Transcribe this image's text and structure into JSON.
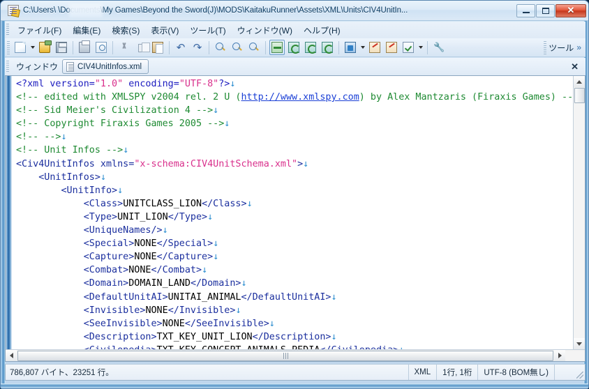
{
  "window": {
    "title": "C:\\Users\\            \\Documents\\My Games\\Beyond the Sword(J)\\MODS\\KaitakuRunner\\Assets\\XML\\Units\\CIV4UnitIn...",
    "app_icon_name": "editor-app-icon",
    "buttons": {
      "minimize": "–",
      "maximize": "□",
      "close": "✕"
    }
  },
  "menubar": {
    "items": [
      {
        "label": "ファイル(F)"
      },
      {
        "label": "編集(E)"
      },
      {
        "label": "検索(S)"
      },
      {
        "label": "表示(V)"
      },
      {
        "label": "ツール(T)"
      },
      {
        "label": "ウィンドウ(W)"
      },
      {
        "label": "ヘルプ(H)"
      }
    ]
  },
  "toolbar": {
    "tools_label": "ツール",
    "overflow_chevron": "»",
    "icons": [
      "new-file-icon",
      "new-file-dropdown-arrow",
      "open-folder-icon",
      "save-icon",
      "print-icon",
      "print-preview-icon",
      "cut-icon",
      "copy-icon",
      "paste-icon",
      "undo-icon",
      "redo-icon",
      "find-icon",
      "find-next-icon",
      "replace-icon",
      "validate-wellformed-icon",
      "validate-schema-icon",
      "reload-icon",
      "export-icon",
      "encoding-icon",
      "encoding-dropdown-arrow",
      "run-script-icon",
      "run-macro-icon",
      "check-icon",
      "check-dropdown-arrow",
      "options-wrench-icon"
    ]
  },
  "tabbar": {
    "window_menu_label": "ウィンドウ",
    "tabs": [
      {
        "label": "CIV4UnitInfos.xml",
        "icon": "xml-file-icon",
        "active": true
      }
    ],
    "close_label": "✕"
  },
  "editor": {
    "lines": [
      [
        {
          "t": "<?xml version=",
          "c": "t-decl"
        },
        {
          "t": "\"1.0\"",
          "c": "t-val"
        },
        {
          "t": " encoding=",
          "c": "t-decl"
        },
        {
          "t": "\"UTF-8\"",
          "c": "t-val"
        },
        {
          "t": "?>",
          "c": "t-decl"
        },
        {
          "t": "↓",
          "c": "t-cr"
        }
      ],
      [
        {
          "t": "<!-- edited with XMLSPY v2004 rel. 2 U (",
          "c": "t-comment"
        },
        {
          "t": "http://www.xmlspy.com",
          "c": "t-link"
        },
        {
          "t": ") by Alex Mantzaris (Firaxis Games) -->",
          "c": "t-comment"
        }
      ],
      [
        {
          "t": "<!-- Sid Meier's Civilization 4 -->",
          "c": "t-comment"
        },
        {
          "t": "↓",
          "c": "t-cr"
        }
      ],
      [
        {
          "t": "<!-- Copyright Firaxis Games 2005 -->",
          "c": "t-comment"
        },
        {
          "t": "↓",
          "c": "t-cr"
        }
      ],
      [
        {
          "t": "<!-- -->",
          "c": "t-comment"
        },
        {
          "t": "↓",
          "c": "t-cr"
        }
      ],
      [
        {
          "t": "<!-- Unit Infos -->",
          "c": "t-comment"
        },
        {
          "t": "↓",
          "c": "t-cr"
        }
      ],
      [
        {
          "t": "<Civ4UnitInfos xmlns=",
          "c": "t-tag"
        },
        {
          "t": "\"x-schema:CIV4UnitSchema.xml\"",
          "c": "t-val"
        },
        {
          "t": ">",
          "c": "t-tag"
        },
        {
          "t": "↓",
          "c": "t-cr"
        }
      ],
      [
        {
          "t": "    <UnitInfos>",
          "c": "t-tag"
        },
        {
          "t": "↓",
          "c": "t-cr"
        }
      ],
      [
        {
          "t": "        <UnitInfo>",
          "c": "t-tag"
        },
        {
          "t": "↓",
          "c": "t-cr"
        }
      ],
      [
        {
          "t": "            <Class>",
          "c": "t-tag"
        },
        {
          "t": "UNITCLASS_LION",
          "c": "t-text"
        },
        {
          "t": "</Class>",
          "c": "t-tag"
        },
        {
          "t": "↓",
          "c": "t-cr"
        }
      ],
      [
        {
          "t": "            <Type>",
          "c": "t-tag"
        },
        {
          "t": "UNIT_LION",
          "c": "t-text"
        },
        {
          "t": "</Type>",
          "c": "t-tag"
        },
        {
          "t": "↓",
          "c": "t-cr"
        }
      ],
      [
        {
          "t": "            <UniqueNames/>",
          "c": "t-tag"
        },
        {
          "t": "↓",
          "c": "t-cr"
        }
      ],
      [
        {
          "t": "            <Special>",
          "c": "t-tag"
        },
        {
          "t": "NONE",
          "c": "t-text"
        },
        {
          "t": "</Special>",
          "c": "t-tag"
        },
        {
          "t": "↓",
          "c": "t-cr"
        }
      ],
      [
        {
          "t": "            <Capture>",
          "c": "t-tag"
        },
        {
          "t": "NONE",
          "c": "t-text"
        },
        {
          "t": "</Capture>",
          "c": "t-tag"
        },
        {
          "t": "↓",
          "c": "t-cr"
        }
      ],
      [
        {
          "t": "            <Combat>",
          "c": "t-tag"
        },
        {
          "t": "NONE",
          "c": "t-text"
        },
        {
          "t": "</Combat>",
          "c": "t-tag"
        },
        {
          "t": "↓",
          "c": "t-cr"
        }
      ],
      [
        {
          "t": "            <Domain>",
          "c": "t-tag"
        },
        {
          "t": "DOMAIN_LAND",
          "c": "t-text"
        },
        {
          "t": "</Domain>",
          "c": "t-tag"
        },
        {
          "t": "↓",
          "c": "t-cr"
        }
      ],
      [
        {
          "t": "            <DefaultUnitAI>",
          "c": "t-tag"
        },
        {
          "t": "UNITAI_ANIMAL",
          "c": "t-text"
        },
        {
          "t": "</DefaultUnitAI>",
          "c": "t-tag"
        },
        {
          "t": "↓",
          "c": "t-cr"
        }
      ],
      [
        {
          "t": "            <Invisible>",
          "c": "t-tag"
        },
        {
          "t": "NONE",
          "c": "t-text"
        },
        {
          "t": "</Invisible>",
          "c": "t-tag"
        },
        {
          "t": "↓",
          "c": "t-cr"
        }
      ],
      [
        {
          "t": "            <SeeInvisible>",
          "c": "t-tag"
        },
        {
          "t": "NONE",
          "c": "t-text"
        },
        {
          "t": "</SeeInvisible>",
          "c": "t-tag"
        },
        {
          "t": "↓",
          "c": "t-cr"
        }
      ],
      [
        {
          "t": "            <Description>",
          "c": "t-tag"
        },
        {
          "t": "TXT_KEY_UNIT_LION",
          "c": "t-text"
        },
        {
          "t": "</Description>",
          "c": "t-tag"
        },
        {
          "t": "↓",
          "c": "t-cr"
        }
      ],
      [
        {
          "t": "            <Civilopedia>",
          "c": "t-tag"
        },
        {
          "t": "TXT_KEY_CONCEPT_ANIMALS_PEDIA",
          "c": "t-text"
        },
        {
          "t": "</Civilopedia>",
          "c": "t-tag"
        },
        {
          "t": "↓",
          "c": "t-cr"
        }
      ]
    ]
  },
  "statusbar": {
    "file_info": "786,807 バイト、23251 行。",
    "file_type": "XML",
    "caret_position": "1行, 1桁",
    "encoding": "UTF-8 (BOM無し)"
  },
  "colors": {
    "titlebar_accent": "#cfe2f4",
    "close_button": "#c6371c",
    "comment_green": "#1e8a32",
    "tag_blue": "#1b2f9e",
    "attr_value_pink": "#d9308c",
    "link_blue": "#1a3fd6",
    "gutter_blue": "#1f63a6"
  }
}
